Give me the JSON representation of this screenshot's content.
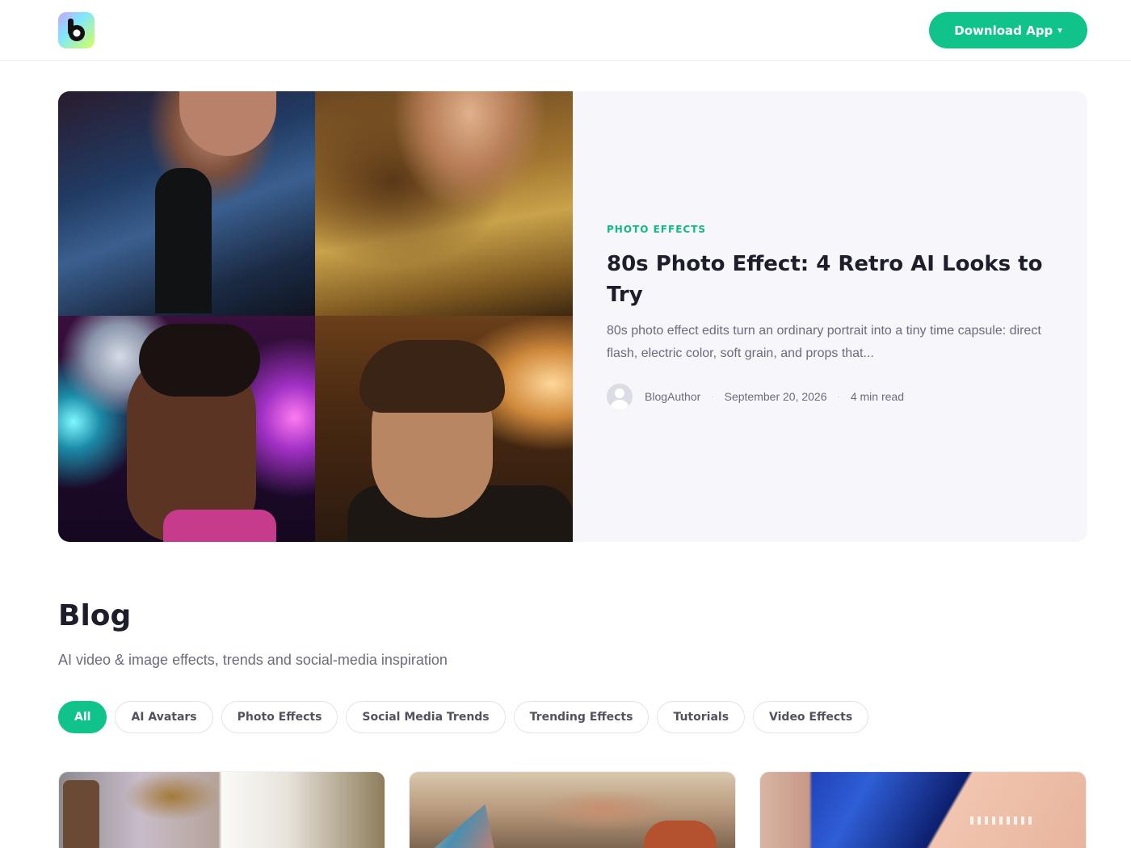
{
  "header": {
    "logo_alt": "b",
    "download_label": "Download App",
    "download_caret": "▾"
  },
  "featured": {
    "category": "PHOTO EFFECTS",
    "title": "80s Photo Effect: 4 Retro AI Looks to Try",
    "excerpt": "80s photo effect edits turn an ordinary portrait into a tiny time capsule: direct flash, electric color, soft grain, and props that...",
    "author": "BlogAuthor",
    "date": "September 20, 2026",
    "read_time": "4 min read",
    "separator": "·"
  },
  "blog": {
    "title": "Blog",
    "subtitle": "AI video & image effects, trends and social-media inspiration"
  },
  "filters": [
    {
      "label": "All",
      "active": true
    },
    {
      "label": "AI Avatars",
      "active": false
    },
    {
      "label": "Photo Effects",
      "active": false
    },
    {
      "label": "Social Media Trends",
      "active": false
    },
    {
      "label": "Trending Effects",
      "active": false
    },
    {
      "label": "Tutorials",
      "active": false
    },
    {
      "label": "Video Effects",
      "active": false
    }
  ],
  "colors": {
    "accent": "#10c38a",
    "category": "#10b981",
    "text": "#1d1d2b",
    "muted": "#6b6b7e",
    "card_bg": "#f6f6fb"
  },
  "icons": {
    "logo": "b-logo-icon",
    "caret": "chevron-down-icon",
    "avatar": "user-avatar-icon"
  }
}
